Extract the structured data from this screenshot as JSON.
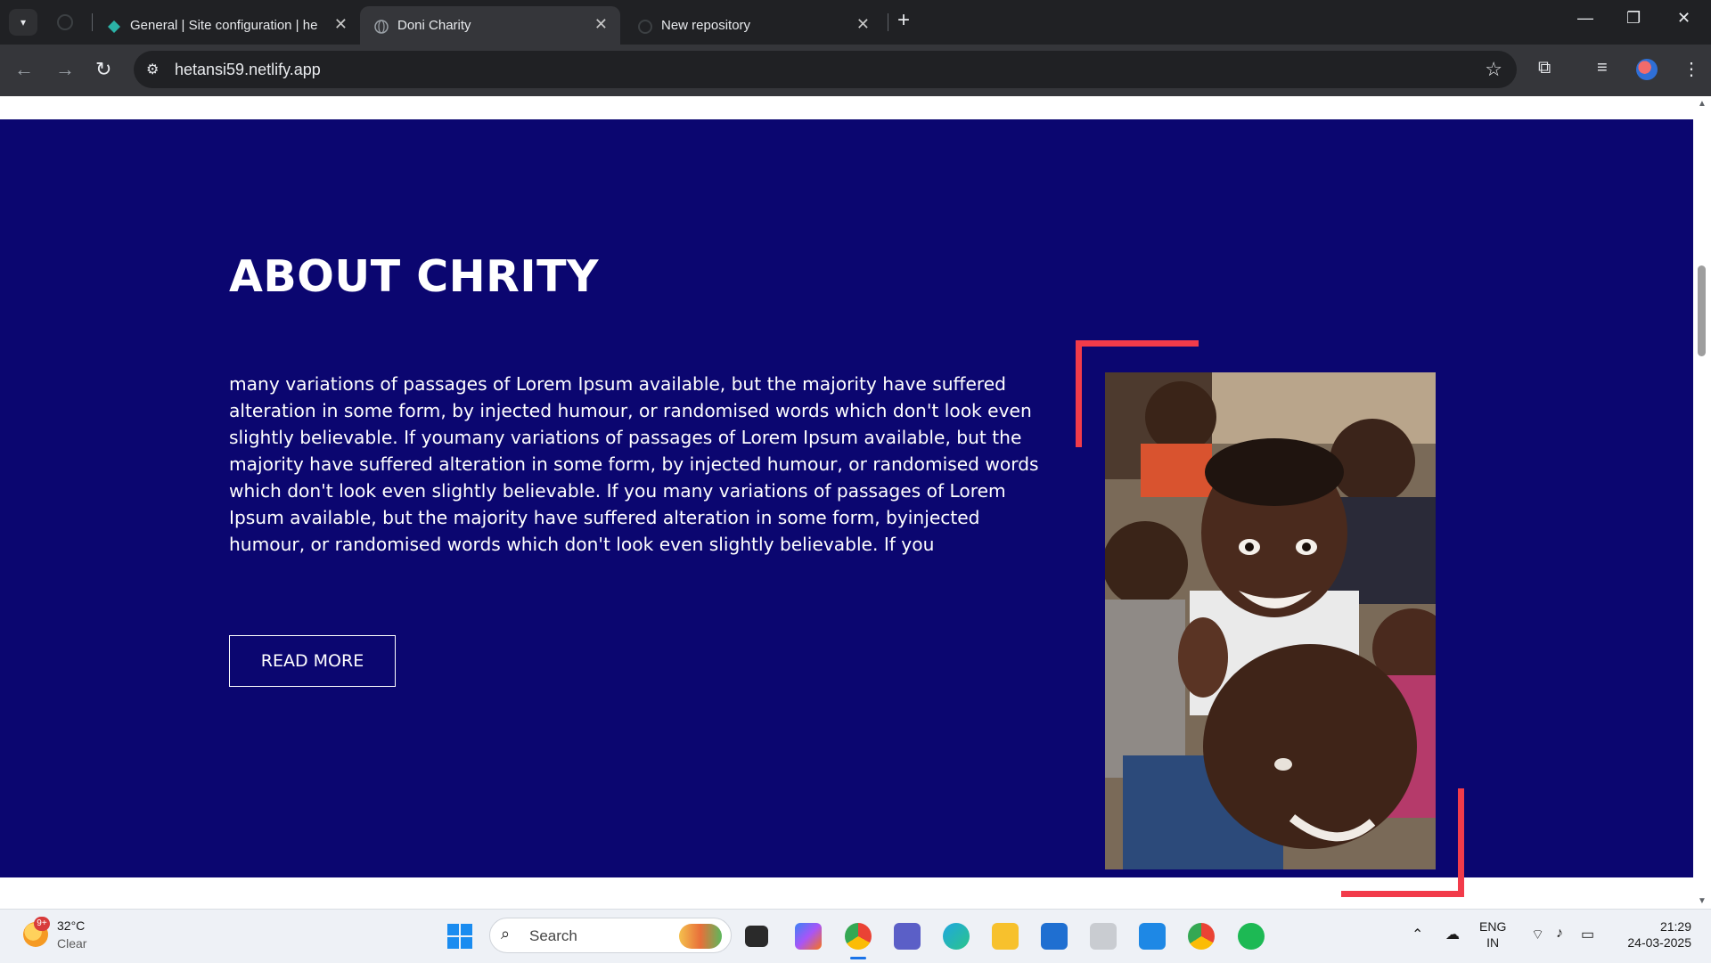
{
  "browser": {
    "tabs": [
      {
        "title": "General | Site configuration | he",
        "active": false
      },
      {
        "title": "Doni Charity",
        "active": true
      },
      {
        "title": "New repository",
        "active": false
      }
    ],
    "tab_close_glyph": "✕",
    "new_tab_glyph": "+",
    "url": "hetansi59.netlify.app",
    "icons": [
      "tab-list-icon",
      "github-icon",
      "netlify-icon",
      "globe-icon",
      "back-arrow-icon",
      "forward-arrow-icon",
      "reload-icon",
      "site-info-icon",
      "star-icon",
      "extensions-icon",
      "media-icon",
      "profile-icon",
      "kebab-menu-icon",
      "minimize-icon",
      "restore-icon",
      "close-icon"
    ]
  },
  "page": {
    "about": {
      "title": "ABOUT CHRITY",
      "body": "many variations of passages of Lorem Ipsum available, but the majority have suffered alteration in some form, by injected humour, or randomised words which don't look even slightly believable. If youmany variations of passages of Lorem Ipsum available, but the majority have suffered alteration in some form, by injected humour, or randomised words which don't look even slightly believable. If you many variations of passages of Lorem Ipsum available, but the majority have suffered alteration in some form, byinjected humour, or randomised words which don't look even slightly believable. If you",
      "button": "READ MORE",
      "image_alt": "smiling children photo"
    },
    "colors": {
      "section_bg": "#0b0670",
      "accent_frame": "#f23b4a",
      "text": "#ffffff"
    }
  },
  "taskbar": {
    "weather": {
      "temp": "32°C",
      "condition": "Clear",
      "badge": "9+"
    },
    "search_placeholder": "Search",
    "lang_line1": "ENG",
    "lang_line2": "IN",
    "time": "21:29",
    "date": "24-03-2025",
    "apps": [
      "task-view-icon",
      "copilot-icon",
      "chrome-icon",
      "teams-icon",
      "edge-icon",
      "file-explorer-icon",
      "store-icon",
      "snipping-icon",
      "vscode-icon",
      "chrome-icon",
      "spotify-icon"
    ]
  }
}
